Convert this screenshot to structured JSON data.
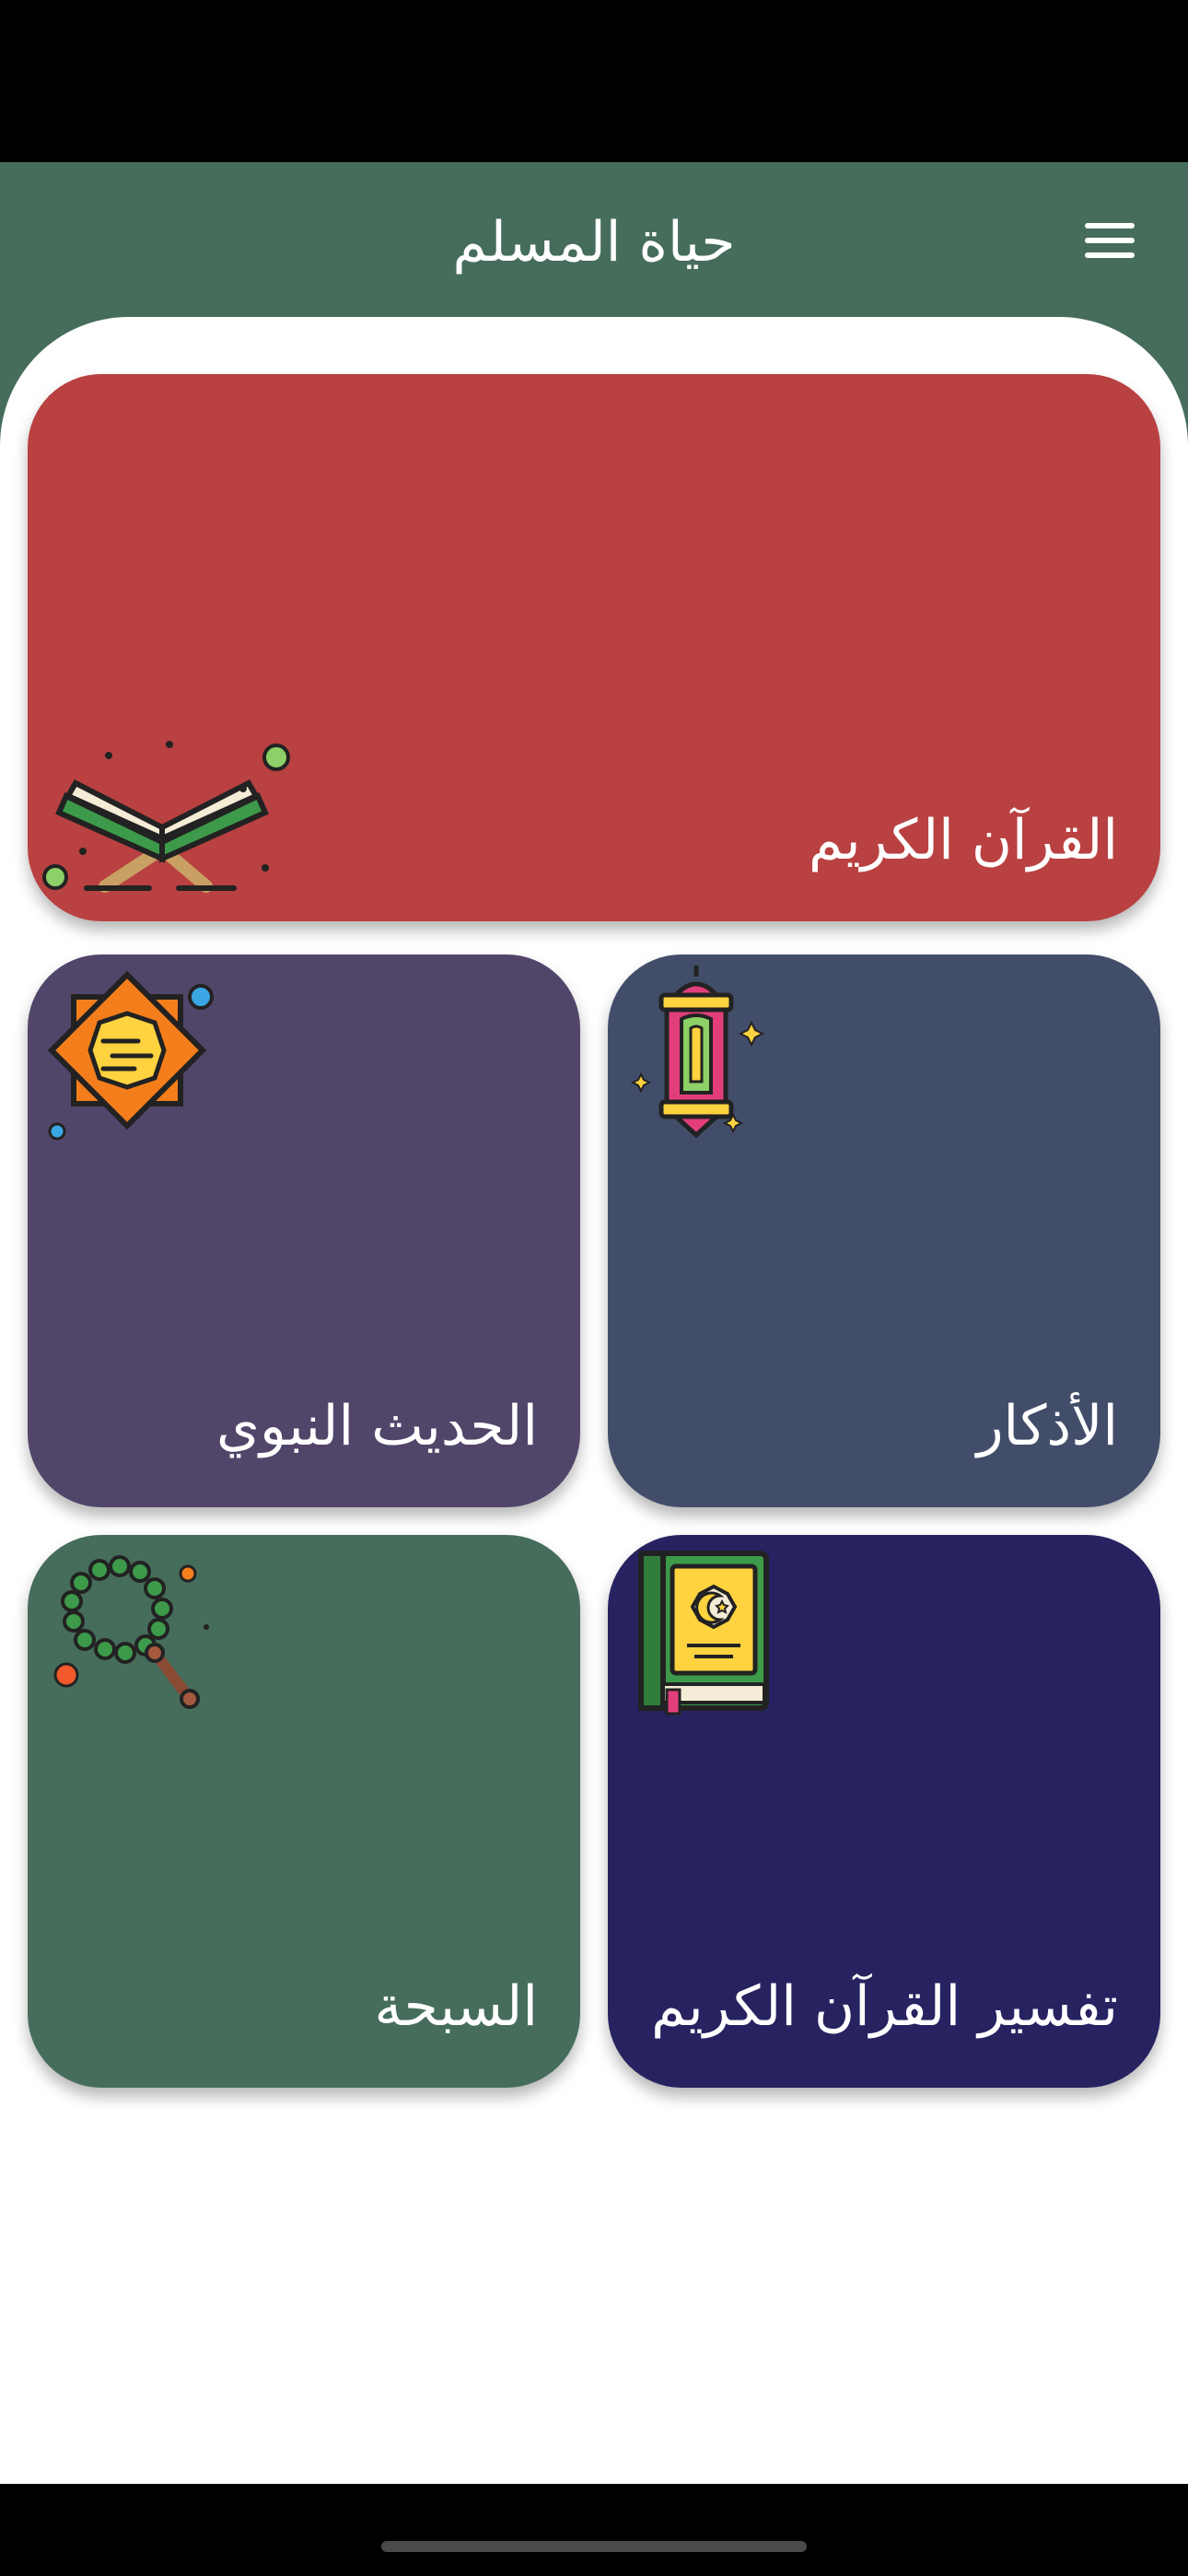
{
  "app": {
    "title": "حياة المسلم"
  },
  "cards": {
    "quran": {
      "label": "القرآن الكريم",
      "color": "#b94141"
    },
    "hadith": {
      "label": "الحديث النبوي",
      "color": "#51466a"
    },
    "adhkar": {
      "label": "الأذكار",
      "color": "#424d6a"
    },
    "tasbih": {
      "label": "السبحة",
      "color": "#466d5c"
    },
    "tafsir": {
      "label": "تفسير القرآن الكريم",
      "color": "#272260"
    }
  },
  "icons": {
    "quran": "open-quran-on-stand-icon",
    "hadith": "star-scroll-icon",
    "adhkar": "ramadan-lantern-icon",
    "tasbih": "prayer-beads-icon",
    "tafsir": "quran-book-icon"
  },
  "theme": {
    "header": "#466d5c",
    "background": "#ffffff"
  }
}
